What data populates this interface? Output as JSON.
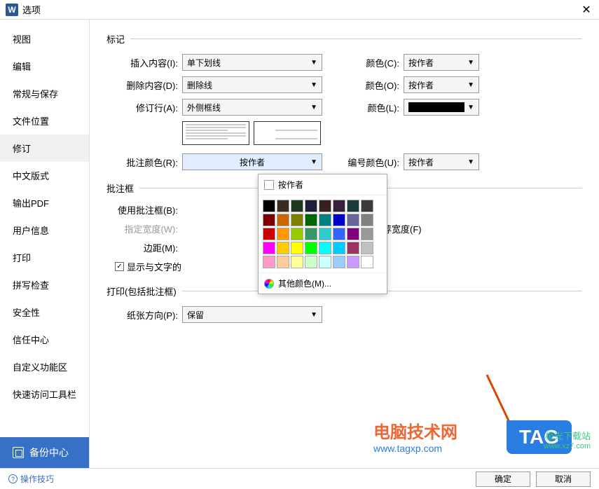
{
  "titlebar": {
    "title": "选项"
  },
  "sidebar": {
    "items": [
      {
        "label": "视图"
      },
      {
        "label": "编辑"
      },
      {
        "label": "常规与保存"
      },
      {
        "label": "文件位置"
      },
      {
        "label": "修订"
      },
      {
        "label": "中文版式"
      },
      {
        "label": "输出PDF"
      },
      {
        "label": "用户信息"
      },
      {
        "label": "打印"
      },
      {
        "label": "拼写检查"
      },
      {
        "label": "安全性"
      },
      {
        "label": "信任中心"
      },
      {
        "label": "自定义功能区"
      },
      {
        "label": "快速访问工具栏"
      }
    ],
    "backup": "备份中心"
  },
  "groups": {
    "marking": {
      "title": "标记",
      "insert_label": "插入内容(I):",
      "insert_value": "单下划线",
      "delete_label": "删除内容(D):",
      "delete_value": "删除线",
      "revline_label": "修订行(A):",
      "revline_value": "外侧框线",
      "colorC_label": "颜色(C):",
      "colorC_value": "按作者",
      "colorO_label": "颜色(O):",
      "colorO_value": "按作者",
      "colorL_label": "颜色(L):",
      "comment_color_label": "批注颜色(R):",
      "comment_color_value": "按作者",
      "number_color_label": "编号颜色(U):",
      "number_color_value": "按作者"
    },
    "commentbox": {
      "title": "批注框",
      "use_label": "使用批注框(B):",
      "width_label": "指定宽度(W):",
      "margin_label": "边距(M):",
      "recommend_label": "使用推荐宽度(F)",
      "show_label": "显示与文字的"
    },
    "print": {
      "title": "打印(包括批注框)",
      "orientation_label": "纸张方向(P):",
      "orientation_value": "保留"
    }
  },
  "color_popup": {
    "by_author": "按作者",
    "more_colors": "其他颜色(M)...",
    "colors": [
      [
        "#000000",
        "#3b2b1e",
        "#1e3a1e",
        "#1e1e3b",
        "#3b1e1e",
        "#3b1e3b",
        "#1e3b3b",
        "#3b3b3b"
      ],
      [
        "#800000",
        "#cc6600",
        "#808000",
        "#006600",
        "#008080",
        "#0000cc",
        "#666699",
        "#808080"
      ],
      [
        "#cc0000",
        "#ff9900",
        "#99cc00",
        "#339966",
        "#33cccc",
        "#3366ff",
        "#800080",
        "#999999"
      ],
      [
        "#ff00ff",
        "#ffcc00",
        "#ffff00",
        "#00ff00",
        "#00ffff",
        "#00ccff",
        "#993366",
        "#c0c0c0"
      ],
      [
        "#ff99cc",
        "#ffcc99",
        "#ffff99",
        "#ccffcc",
        "#ccffff",
        "#99ccff",
        "#cc99ff",
        "#ffffff"
      ]
    ]
  },
  "footer": {
    "tip": "操作技巧",
    "ok": "确定",
    "cancel": "取消"
  },
  "watermarks": {
    "cnjsw": "电脑技术网",
    "tagxp": "www.tagxp.com",
    "tag": "TAG",
    "jg1": "极光下载站",
    "jg2": "www.xz7.com"
  }
}
